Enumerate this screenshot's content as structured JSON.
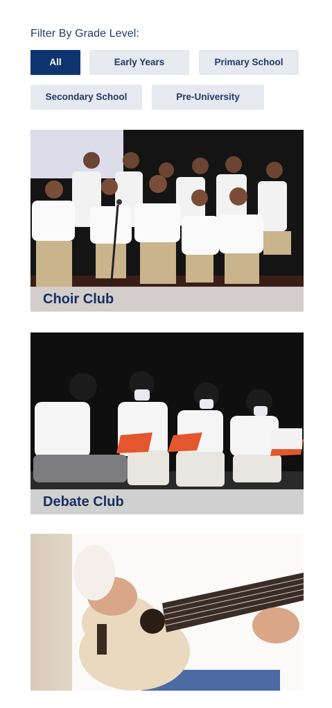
{
  "filter": {
    "title": "Filter By Grade Level:",
    "options": [
      "All",
      "Early Years",
      "Primary School",
      "Secondary School",
      "Pre-University"
    ],
    "selected": "All"
  },
  "clubs": [
    {
      "name": "Choir Club",
      "image": "choir-photo"
    },
    {
      "name": "Debate Club",
      "image": "debate-photo"
    },
    {
      "name": "",
      "image": "ukulele-photo"
    }
  ],
  "colors": {
    "accent": "#0f3570",
    "chip_bg": "#e6e9ef",
    "text": "#14305f"
  }
}
